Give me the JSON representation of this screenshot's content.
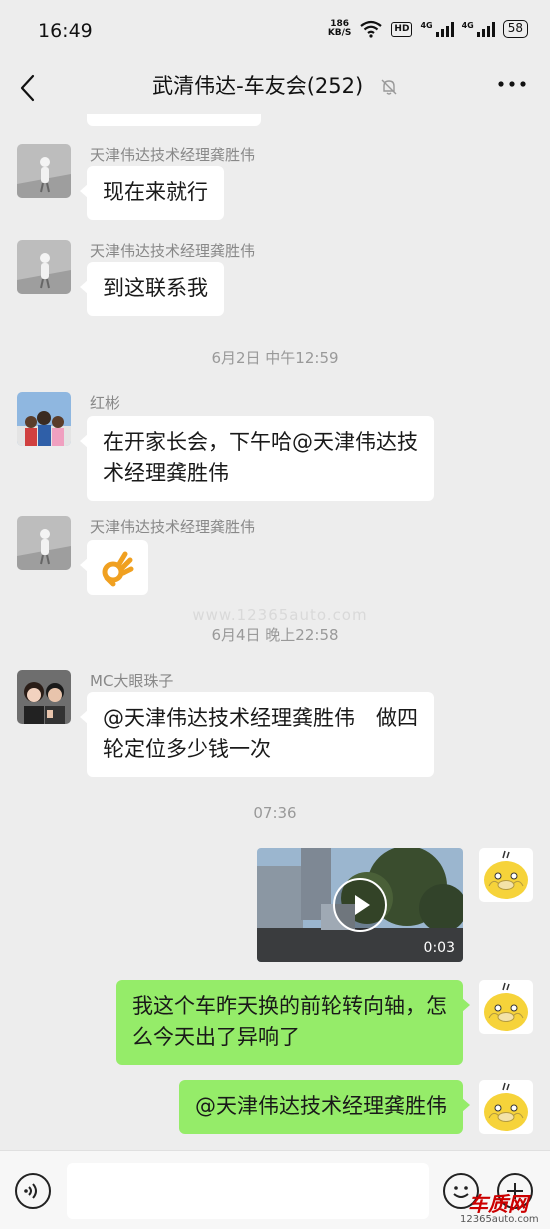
{
  "status_bar": {
    "time": "16:49",
    "net_speed_value": "186",
    "net_speed_unit": "KB/S",
    "hd_label": "HD",
    "sig1_label": "4G",
    "sig2_label": "4G",
    "battery": "58"
  },
  "header": {
    "title": "武清伟达-车友会(252)",
    "icons": [
      "back-arrow-icon",
      "mute-bell-icon",
      "more-dots-icon"
    ]
  },
  "messages": [
    {
      "side": "left",
      "sender": "天津伟达技术经理龚胜伟",
      "text": "现在来就行",
      "avatar": "person-photo-gray"
    },
    {
      "side": "left",
      "sender": "天津伟达技术经理龚胜伟",
      "text": "到这联系我",
      "avatar": "person-photo-gray"
    },
    {
      "type": "time",
      "text": "6月2日 中午12:59"
    },
    {
      "side": "left",
      "sender": "红彬",
      "text_line1": "在开家长会，下午哈@天津伟达技",
      "text_line2": "术经理龚胜伟",
      "avatar": "family-photo"
    },
    {
      "side": "left",
      "sender": "天津伟达技术经理龚胜伟",
      "emoji": "ok-hand",
      "avatar": "person-photo-gray"
    },
    {
      "type": "watermark",
      "text": "www.12365auto.com"
    },
    {
      "type": "time",
      "text": "6月4日 晚上22:58"
    },
    {
      "side": "left",
      "sender": "MC大眼珠子",
      "text_line1": "@天津伟达技术经理龚胜伟　做四",
      "text_line2": "轮定位多少钱一次",
      "avatar": "couple-photo"
    },
    {
      "type": "time",
      "text": "07:36"
    },
    {
      "side": "right",
      "type": "video",
      "duration": "0:03",
      "avatar": "psyduck"
    },
    {
      "side": "right",
      "text_line1": "我这个车昨天换的前轮转向轴，怎",
      "text_line2": "么今天出了异响了",
      "avatar": "psyduck"
    },
    {
      "side": "right",
      "text": "@天津伟达技术经理龚胜伟",
      "avatar": "psyduck"
    }
  ],
  "footer": {
    "input_value": "",
    "logo_text": "车质网",
    "logo_url": "12365auto.com",
    "icons": [
      "voice-icon",
      "emoji-icon",
      "plus-icon"
    ]
  },
  "colors": {
    "background": "#ededed",
    "left_bubble": "#ffffff",
    "right_bubble": "#95ec69",
    "meta_text": "#888888"
  }
}
